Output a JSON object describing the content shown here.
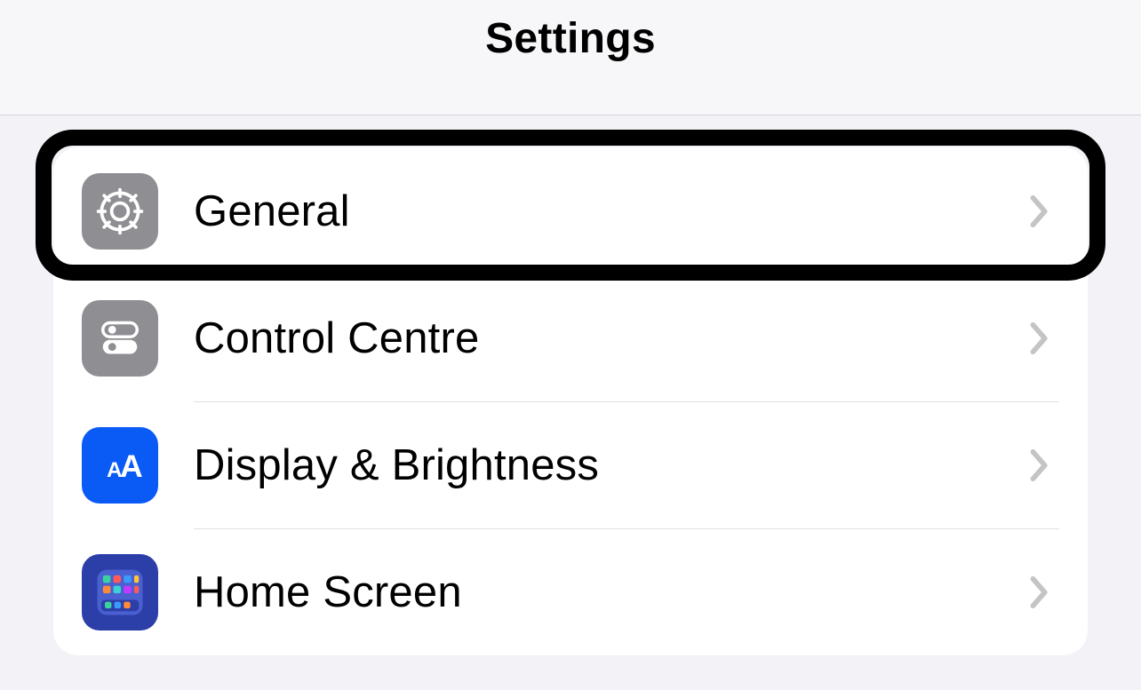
{
  "header": {
    "title": "Settings"
  },
  "rows": [
    {
      "label": "General",
      "icon": "gear-icon",
      "highlighted": true
    },
    {
      "label": "Control Centre",
      "icon": "toggles-icon",
      "highlighted": false
    },
    {
      "label": "Display & Brightness",
      "icon": "text-size-icon",
      "highlighted": false
    },
    {
      "label": "Home Screen",
      "icon": "app-grid-icon",
      "highlighted": false
    }
  ],
  "colors": {
    "grayIcon": "#8e8e93",
    "blueIcon": "#0a5af5",
    "indigoIcon": "#2c3ea7",
    "background": "#f2f2f7",
    "divider": "#e0e0e3",
    "chevron": "#c4c4c7"
  }
}
